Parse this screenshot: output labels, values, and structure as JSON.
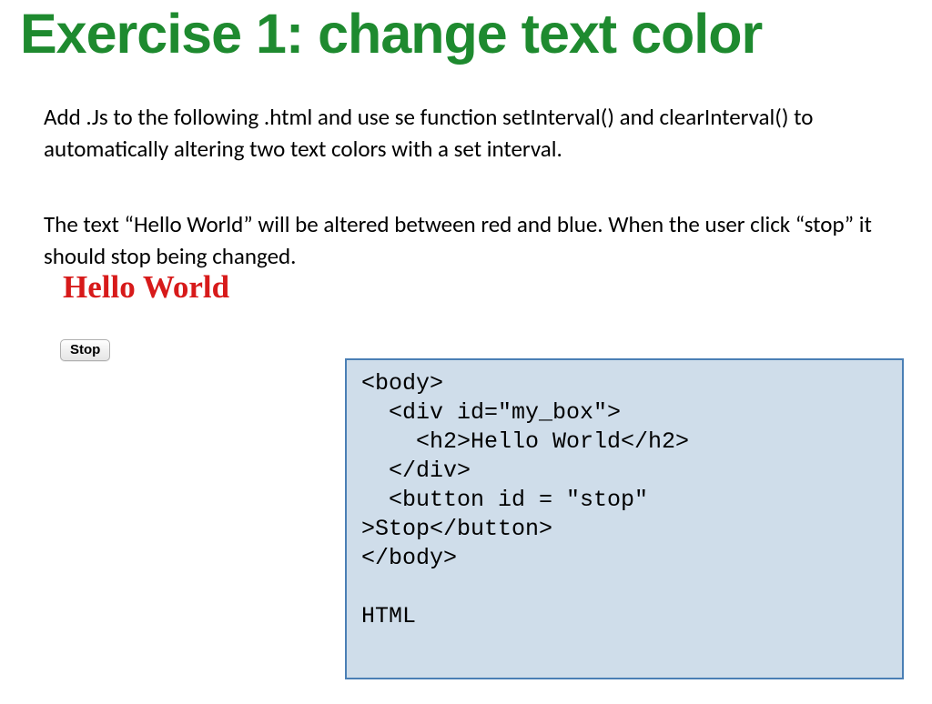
{
  "title": "Exercise 1: change text color",
  "paragraph1": "Add .Js to the following .html  and use se function setInterval() and clearInterval() to automatically altering two text colors with a set interval.",
  "paragraph2": "The text “Hello World” will be altered between red and blue. When the user click “stop” it should stop being changed.",
  "hello_world_text": "Hello World",
  "stop_button_label": "Stop",
  "code_box_content": "<body>\n  <div id=\"my_box\">\n    <h2>Hello World</h2>\n  </div>\n  <button id = \"stop\" \n>Stop</button>\n</body>\n\nHTML",
  "colors": {
    "title_green": "#1e8a2f",
    "hello_red": "#d71a1a",
    "code_bg": "#cfddea",
    "code_border": "#4a7fb5"
  }
}
